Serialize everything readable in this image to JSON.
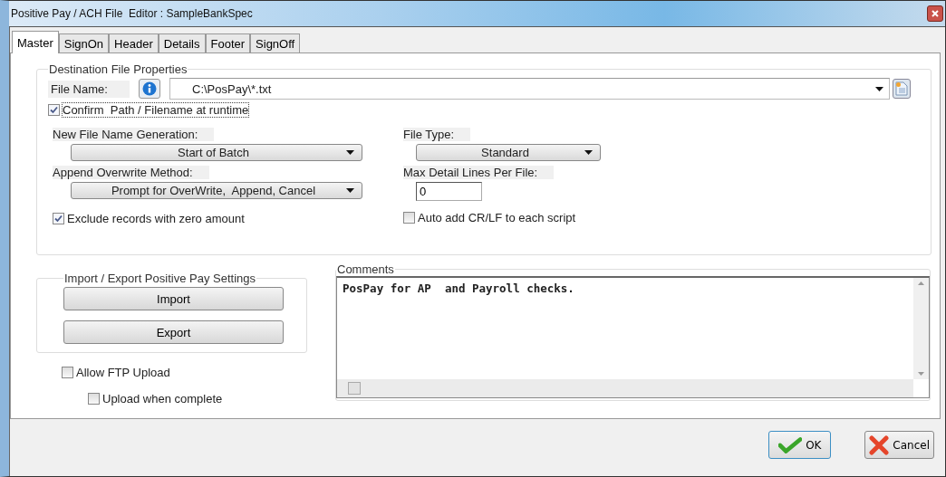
{
  "window": {
    "title": "Positive Pay / ACH File  Editor : SampleBankSpec"
  },
  "tabs": [
    {
      "label": "Master",
      "selected": true
    },
    {
      "label": "SignOn",
      "selected": false
    },
    {
      "label": "Header",
      "selected": false
    },
    {
      "label": "Details",
      "selected": false
    },
    {
      "label": "Footer",
      "selected": false
    },
    {
      "label": "SignOff",
      "selected": false
    }
  ],
  "destination": {
    "title": "Destination File Properties",
    "file_name_label": "File Name:",
    "file_name_value": "C:\\PosPay\\*.txt",
    "confirm": {
      "label": "Confirm  Path / Filename at runtime",
      "checked": true
    },
    "new_file_name_generation": {
      "label": "New File Name Generation:",
      "value": "Start of Batch"
    },
    "file_type": {
      "label": "File Type:",
      "value": "Standard"
    },
    "append_overwrite_method": {
      "label": "Append Overwrite Method:",
      "value": "Prompt for OverWrite,  Append, Cancel"
    },
    "max_detail_lines": {
      "label": "Max Detail Lines Per File:",
      "value": "0"
    },
    "exclude_zero": {
      "label": "Exclude records with zero amount",
      "checked": true
    },
    "auto_crlf": {
      "label": "Auto add CR/LF to each script",
      "checked": false
    }
  },
  "import_export": {
    "title": "Import / Export Positive Pay Settings",
    "buttons": [
      "Import",
      "Export"
    ]
  },
  "ftp": {
    "allow": {
      "label": "Allow FTP Upload",
      "checked": false
    },
    "upload_when_complete": {
      "label": "Upload when complete",
      "checked": false
    }
  },
  "comments": {
    "title": "Comments",
    "text": "PosPay for AP  and Payroll checks."
  },
  "buttons": {
    "ok": "OK",
    "cancel": "Cancel"
  }
}
